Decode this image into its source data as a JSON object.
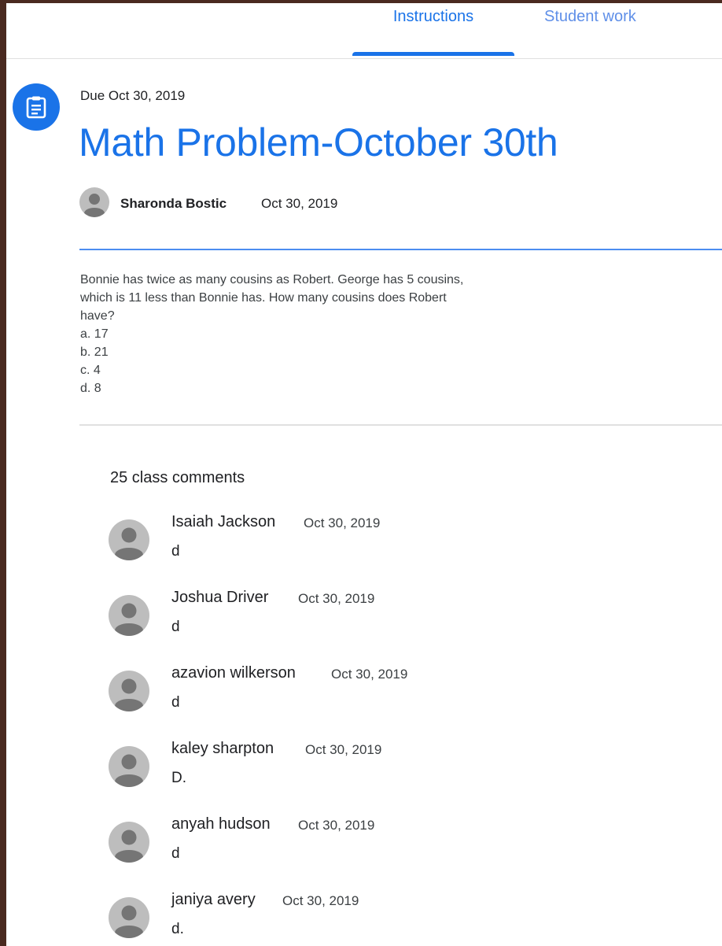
{
  "tabs": [
    {
      "label": "Instructions",
      "active": true
    },
    {
      "label": "Student work",
      "active": false
    }
  ],
  "assignment": {
    "icon": "assignment-icon",
    "due": "Due Oct 30, 2019",
    "title": "Math Problem-October 30th",
    "author": "Sharonda Bostic",
    "date": "Oct 30, 2019",
    "instructions": [
      "Bonnie has twice as many cousins as Robert. George has 5 cousins,",
      "which is 11 less than Bonnie has. How many cousins does Robert",
      "have?",
      "a. 17",
      "b. 21",
      "c. 4",
      "d. 8"
    ]
  },
  "comments": {
    "count_label": "25 class comments",
    "items": [
      {
        "name": "Isaiah Jackson",
        "date": "Oct 30, 2019",
        "text": "d"
      },
      {
        "name": "Joshua Driver",
        "date": "Oct 30, 2019",
        "text": "d"
      },
      {
        "name": "azavion wilkerson",
        "date": "Oct 30, 2019",
        "text": "d"
      },
      {
        "name": "kaley sharpton",
        "date": "Oct 30, 2019",
        "text": "D."
      },
      {
        "name": "anyah hudson",
        "date": "Oct 30, 2019",
        "text": "d"
      },
      {
        "name": "janiya avery",
        "date": "Oct 30, 2019",
        "text": "d."
      }
    ]
  },
  "colors": {
    "accent": "#1a73e8",
    "avatar": "#bdbdbd"
  }
}
